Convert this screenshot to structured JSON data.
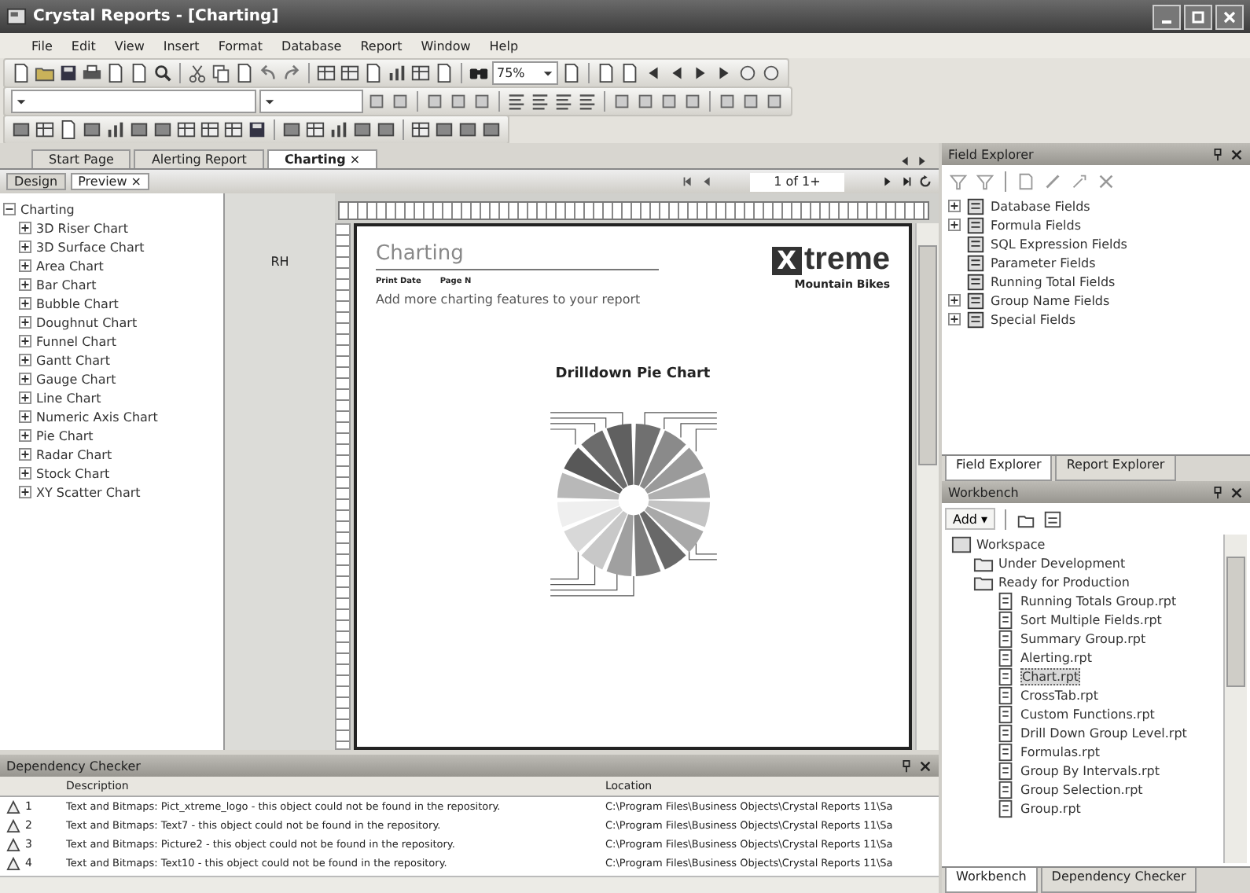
{
  "window": {
    "title": "Crystal Reports - [Charting]"
  },
  "menu": [
    "File",
    "Edit",
    "View",
    "Insert",
    "Format",
    "Database",
    "Report",
    "Window",
    "Help"
  ],
  "toolbar": {
    "zoom": "75%"
  },
  "document_tabs": [
    {
      "label": "Start Page",
      "selected": false
    },
    {
      "label": "Alerting Report",
      "selected": false
    },
    {
      "label": "Charting",
      "selected": true,
      "close": "×"
    }
  ],
  "view_tabs": [
    {
      "label": "Design",
      "selected": false
    },
    {
      "label": "Preview",
      "selected": true,
      "close": "×"
    }
  ],
  "page_nav": "1 of 1+",
  "group_tree": {
    "label": "Charting",
    "children": [
      {
        "label": "3D Riser Chart"
      },
      {
        "label": "3D Surface Chart"
      },
      {
        "label": "Area Chart"
      },
      {
        "label": "Bar Chart"
      },
      {
        "label": "Bubble Chart"
      },
      {
        "label": "Doughnut Chart"
      },
      {
        "label": "Funnel Chart"
      },
      {
        "label": "Gantt Chart"
      },
      {
        "label": "Gauge Chart"
      },
      {
        "label": "Line Chart"
      },
      {
        "label": "Numeric Axis Chart"
      },
      {
        "label": "Pie Chart"
      },
      {
        "label": "Radar Chart"
      },
      {
        "label": "Stock Chart"
      },
      {
        "label": "XY Scatter Chart"
      }
    ]
  },
  "section_label": "RH",
  "report": {
    "title": "Charting",
    "print_date": "Print Date",
    "page_count": "Page N",
    "subtitle": "Add more charting features to your report",
    "logo_mark": "X",
    "logo_word": "treme",
    "logo_sub": "Mountain Bikes",
    "chart_title": "Drilldown Pie Chart"
  },
  "field_explorer": {
    "title": "Field Explorer",
    "items": [
      {
        "label": "Database Fields",
        "has_children": true
      },
      {
        "label": "Formula Fields",
        "has_children": true
      },
      {
        "label": "SQL Expression Fields",
        "has_children": false
      },
      {
        "label": "Parameter Fields",
        "has_children": false
      },
      {
        "label": "Running Total Fields",
        "has_children": false
      },
      {
        "label": "Group Name Fields",
        "has_children": true
      },
      {
        "label": "Special Fields",
        "has_children": true
      }
    ]
  },
  "explorer_tabs": [
    {
      "label": "Field Explorer",
      "selected": true
    },
    {
      "label": "Report Explorer",
      "selected": false
    }
  ],
  "workbench": {
    "title": "Workbench",
    "add_button": "Add ▾",
    "tree": [
      {
        "label": "Workspace",
        "kind": "workspace",
        "children": [
          {
            "label": "Under Development",
            "kind": "folder"
          },
          {
            "label": "Ready for Production",
            "kind": "folder",
            "children": [
              {
                "label": "Running Totals Group.rpt",
                "kind": "report",
                "selected": false
              },
              {
                "label": "Sort Multiple Fields.rpt",
                "kind": "report",
                "selected": false
              },
              {
                "label": "Summary Group.rpt",
                "kind": "report",
                "selected": false
              },
              {
                "label": "Alerting.rpt",
                "kind": "report",
                "selected": false
              },
              {
                "label": "Chart.rpt",
                "kind": "report",
                "selected": true
              },
              {
                "label": "CrossTab.rpt",
                "kind": "report",
                "selected": false
              },
              {
                "label": "Custom Functions.rpt",
                "kind": "report",
                "selected": false
              },
              {
                "label": "Drill Down Group Level.rpt",
                "kind": "report",
                "selected": false
              },
              {
                "label": "Formulas.rpt",
                "kind": "report",
                "selected": false
              },
              {
                "label": "Group By Intervals.rpt",
                "kind": "report",
                "selected": false
              },
              {
                "label": "Group Selection.rpt",
                "kind": "report",
                "selected": false
              },
              {
                "label": "Group.rpt",
                "kind": "report",
                "selected": false
              }
            ]
          }
        ]
      }
    ]
  },
  "workbench_tabs": [
    {
      "label": "Workbench",
      "selected": true
    },
    {
      "label": "Dependency Checker",
      "selected": false
    }
  ],
  "dependency_checker": {
    "title": "Dependency Checker",
    "columns": [
      "Description",
      "Location"
    ],
    "rows": [
      {
        "number": "1",
        "description": "Text and Bitmaps: Pict_xtreme_logo - this object could not be found in the repository.",
        "location": "C:\\Program Files\\Business Objects\\Crystal Reports 11\\Sa"
      },
      {
        "number": "2",
        "description": "Text and Bitmaps: Text7 - this object could not be found in the repository.",
        "location": "C:\\Program Files\\Business Objects\\Crystal Reports 11\\Sa"
      },
      {
        "number": "3",
        "description": "Text and Bitmaps: Picture2 - this object could not be found in the repository.",
        "location": "C:\\Program Files\\Business Objects\\Crystal Reports 11\\Sa"
      },
      {
        "number": "4",
        "description": "Text and Bitmaps: Text10 - this object could not be found in the repository.",
        "location": "C:\\Program Files\\Business Objects\\Crystal Reports 11\\Sa"
      }
    ]
  }
}
